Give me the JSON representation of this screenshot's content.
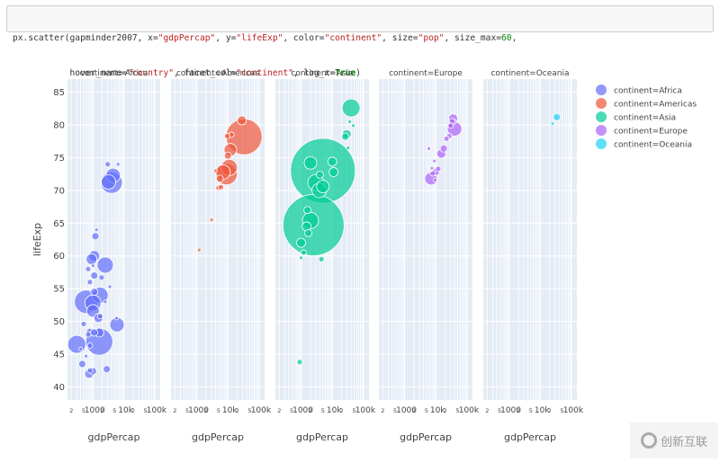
{
  "code": {
    "line1_parts": [
      {
        "t": "px.scatter(gapminder2007, x=",
        "c": ""
      },
      {
        "t": "\"gdpPercap\"",
        "c": "str"
      },
      {
        "t": ", y=",
        "c": ""
      },
      {
        "t": "\"lifeExp\"",
        "c": "str"
      },
      {
        "t": ", color=",
        "c": ""
      },
      {
        "t": "\"continent\"",
        "c": "str"
      },
      {
        "t": ", size=",
        "c": ""
      },
      {
        "t": "\"pop\"",
        "c": "str"
      },
      {
        "t": ", size_max=",
        "c": ""
      },
      {
        "t": "60",
        "c": "num"
      },
      {
        "t": ",",
        "c": ""
      }
    ],
    "line2_parts": [
      {
        "t": "           hover_name=",
        "c": ""
      },
      {
        "t": "\"country\"",
        "c": "str"
      },
      {
        "t": ", facet_col=",
        "c": ""
      },
      {
        "t": "\"continent\"",
        "c": "str"
      },
      {
        "t": ", log_x=",
        "c": ""
      },
      {
        "t": "True",
        "c": "kw"
      },
      {
        "t": ")",
        "c": ""
      }
    ]
  },
  "watermark": {
    "text": "创新互联"
  },
  "chart_data": {
    "type": "scatter",
    "title": "",
    "xlabel": "gdpPercap",
    "ylabel": "lifeExp",
    "x_scale": "log",
    "xlim": [
      150,
      150000
    ],
    "ylim": [
      38,
      87
    ],
    "y_ticks": [
      40,
      45,
      50,
      55,
      60,
      65,
      70,
      75,
      80,
      85
    ],
    "x_ticks": [
      {
        "v": 200,
        "label": "2"
      },
      {
        "v": 500,
        "label": "5"
      },
      {
        "v": 1000,
        "label": "1000"
      },
      {
        "v": 2000,
        "label": "2"
      },
      {
        "v": 5000,
        "label": "5"
      },
      {
        "v": 10000,
        "label": "10k"
      },
      {
        "v": 20000,
        "label": "2"
      },
      {
        "v": 50000,
        "label": "5"
      },
      {
        "v": 100000,
        "label": "100k"
      }
    ],
    "grid": true,
    "legend_position": "top-right",
    "facets": [
      {
        "name": "continent=Africa",
        "color": "#636efa",
        "points": [
          [
            3000,
            74,
            3
          ],
          [
            6500,
            74,
            2
          ],
          [
            4500,
            72.3,
            8
          ],
          [
            4000,
            71.2,
            12
          ],
          [
            3200,
            71.3,
            8
          ],
          [
            1300,
            64,
            2
          ],
          [
            1200,
            63,
            4
          ],
          [
            1100,
            60,
            6
          ],
          [
            900,
            59.5,
            6
          ],
          [
            2500,
            58.6,
            9
          ],
          [
            700,
            58,
            3
          ],
          [
            1000,
            58.5,
            2
          ],
          [
            1100,
            57,
            4
          ],
          [
            1900,
            56.7,
            3
          ],
          [
            800,
            56,
            3
          ],
          [
            3500,
            55.3,
            2
          ],
          [
            1100,
            54.5,
            4
          ],
          [
            1700,
            54,
            9
          ],
          [
            600,
            53,
            13
          ],
          [
            1000,
            52.8,
            9
          ],
          [
            1000,
            51.6,
            7
          ],
          [
            2500,
            53,
            2
          ],
          [
            1700,
            50.8,
            3
          ],
          [
            1500,
            50.5,
            5
          ],
          [
            6000,
            49.5,
            8
          ],
          [
            5800,
            50.5,
            2
          ],
          [
            500,
            49.6,
            3
          ],
          [
            800,
            48.4,
            4
          ],
          [
            1100,
            48.3,
            4
          ],
          [
            1600,
            48.3,
            5
          ],
          [
            700,
            48,
            3
          ],
          [
            300,
            46.5,
            10
          ],
          [
            1600,
            46.9,
            15
          ],
          [
            800,
            46.3,
            3
          ],
          [
            400,
            45.8,
            2
          ],
          [
            600,
            44.7,
            2
          ],
          [
            450,
            43.5,
            4
          ],
          [
            800,
            42.5,
            3
          ],
          [
            750,
            42,
            5
          ],
          [
            1000,
            42.4,
            4
          ],
          [
            2800,
            42.7,
            4
          ]
        ]
      },
      {
        "name": "continent=Americas",
        "color": "#ef553b",
        "points": [
          [
            33000,
            78.2,
            20
          ],
          [
            28000,
            80.7,
            5
          ],
          [
            12000,
            76.2,
            7
          ],
          [
            10000,
            75.3,
            4
          ],
          [
            11000,
            73.5,
            9
          ],
          [
            9000,
            72.5,
            12
          ],
          [
            7000,
            72.8,
            8
          ],
          [
            5500,
            71.8,
            4
          ],
          [
            4000,
            73,
            2
          ],
          [
            5000,
            70.4,
            3
          ],
          [
            6000,
            70.5,
            3
          ],
          [
            3000,
            65.5,
            2
          ],
          [
            1200,
            60.9,
            2
          ],
          [
            13000,
            78.5,
            3
          ],
          [
            9500,
            78.3,
            3
          ]
        ]
      },
      {
        "name": "continent=Asia",
        "color": "#00cc96",
        "points": [
          [
            5000,
            73,
            36
          ],
          [
            2500,
            64.7,
            34
          ],
          [
            40000,
            82.6,
            10
          ],
          [
            36000,
            80.5,
            2
          ],
          [
            47000,
            79.9,
            2
          ],
          [
            29000,
            78.6,
            5
          ],
          [
            26000,
            78.2,
            4
          ],
          [
            32000,
            76.5,
            2
          ],
          [
            10000,
            74.4,
            5
          ],
          [
            11000,
            72.8,
            5
          ],
          [
            2000,
            74.2,
            7
          ],
          [
            4000,
            72.4,
            4
          ],
          [
            3000,
            71.2,
            9
          ],
          [
            5000,
            70.6,
            7
          ],
          [
            3800,
            70,
            8
          ],
          [
            1600,
            67,
            4
          ],
          [
            2000,
            65.4,
            9
          ],
          [
            1500,
            64.5,
            5
          ],
          [
            1700,
            63.5,
            4
          ],
          [
            1000,
            62,
            5
          ],
          [
            1200,
            60.5,
            3
          ],
          [
            1000,
            59.7,
            2
          ],
          [
            4500,
            59.5,
            3
          ],
          [
            900,
            43.8,
            3
          ]
        ]
      },
      {
        "name": "continent=Europe",
        "color": "#ab63fa",
        "points": [
          [
            36000,
            81,
            5
          ],
          [
            37000,
            80.5,
            3
          ],
          [
            40000,
            79.4,
            8
          ],
          [
            33000,
            80.6,
            3
          ],
          [
            30000,
            79.9,
            3
          ],
          [
            27000,
            78.3,
            3
          ],
          [
            22000,
            77.9,
            3
          ],
          [
            18000,
            76.4,
            4
          ],
          [
            15000,
            75.6,
            5
          ],
          [
            9000,
            74.5,
            2
          ],
          [
            12000,
            73.3,
            3
          ],
          [
            10000,
            72.8,
            4
          ],
          [
            7500,
            73.4,
            2
          ],
          [
            9500,
            71.6,
            2
          ],
          [
            6000,
            76.4,
            2
          ],
          [
            7000,
            71.8,
            7
          ],
          [
            8000,
            72.6,
            3
          ]
        ]
      },
      {
        "name": "continent=Oceania",
        "color": "#19d3f3",
        "points": [
          [
            34000,
            81.2,
            4
          ],
          [
            25000,
            80.2,
            2
          ]
        ]
      }
    ]
  }
}
